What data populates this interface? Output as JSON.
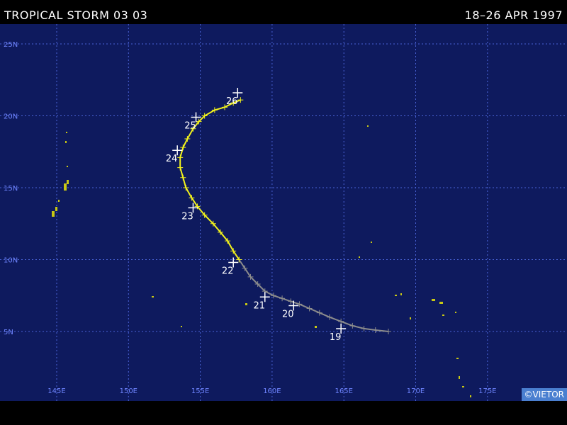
{
  "header": {
    "title": "TROPICAL STORM 03 03",
    "dates": "18–26 APR 1997"
  },
  "credit": "©VIETOR",
  "colors": {
    "ocean": "#0e1a5e",
    "grid": "#4a63d6",
    "grid_label": "#6f85ff",
    "track_storm": "#f2f21c",
    "track_depression": "#8c8c8c",
    "land": "#c8c814",
    "credit_bg": "#4a7fd0"
  },
  "map": {
    "lon_labels": [
      "145E",
      "150E",
      "155E",
      "160E",
      "165E",
      "170E",
      "175E"
    ],
    "lat_labels": [
      "25N",
      "20N",
      "15N",
      "10N",
      "5N"
    ],
    "lon_values": [
      145,
      150,
      155,
      160,
      165,
      170,
      175
    ],
    "lat_values": [
      25,
      20,
      15,
      10,
      5
    ]
  },
  "track": {
    "depression_early": [
      [
        168.1,
        5.0
      ],
      [
        167.2,
        5.1
      ],
      [
        166.4,
        5.2
      ],
      [
        165.6,
        5.4
      ],
      [
        164.8,
        5.7
      ],
      [
        164.0,
        6.0
      ],
      [
        163.3,
        6.3
      ],
      [
        162.6,
        6.6
      ],
      [
        161.9,
        6.9
      ],
      [
        161.3,
        7.1
      ],
      [
        160.7,
        7.3
      ],
      [
        160.1,
        7.5
      ],
      [
        159.5,
        7.8
      ],
      [
        159.0,
        8.3
      ],
      [
        158.5,
        8.8
      ],
      [
        158.1,
        9.4
      ],
      [
        157.7,
        10.0
      ]
    ],
    "storm": [
      [
        157.7,
        10.0
      ],
      [
        157.3,
        10.6
      ],
      [
        156.9,
        11.3
      ],
      [
        156.4,
        11.9
      ],
      [
        155.9,
        12.5
      ],
      [
        155.3,
        13.1
      ],
      [
        154.8,
        13.7
      ],
      [
        154.4,
        14.3
      ],
      [
        154.0,
        15.0
      ],
      [
        153.8,
        15.7
      ],
      [
        153.6,
        16.4
      ],
      [
        153.6,
        17.1
      ],
      [
        153.8,
        17.8
      ],
      [
        154.1,
        18.4
      ],
      [
        154.5,
        19.1
      ],
      [
        154.9,
        19.6
      ],
      [
        155.3,
        20.0
      ],
      [
        156.0,
        20.4
      ],
      [
        156.7,
        20.6
      ],
      [
        157.3,
        20.9
      ],
      [
        157.8,
        21.1
      ]
    ],
    "day_labels": [
      {
        "label": "19",
        "lon": 164.8,
        "lat": 5.2
      },
      {
        "label": "20",
        "lon": 161.5,
        "lat": 6.8
      },
      {
        "label": "21",
        "lon": 159.5,
        "lat": 7.4
      },
      {
        "label": "22",
        "lon": 157.3,
        "lat": 9.8
      },
      {
        "label": "23",
        "lon": 154.5,
        "lat": 13.6
      },
      {
        "label": "24",
        "lon": 153.4,
        "lat": 17.6
      },
      {
        "label": "25",
        "lon": 154.7,
        "lat": 19.9
      },
      {
        "label": "26",
        "lon": 157.6,
        "lat": 21.6
      }
    ]
  }
}
